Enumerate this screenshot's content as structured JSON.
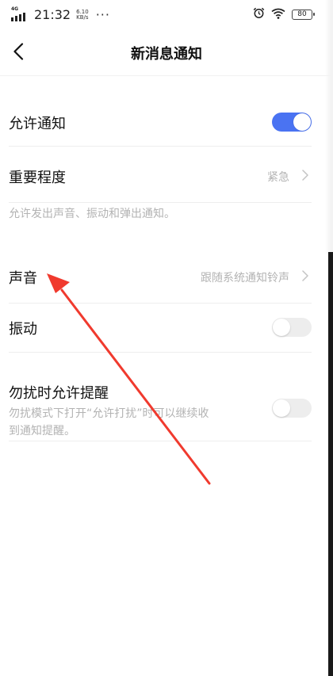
{
  "status_bar": {
    "network_type": "4G",
    "time": "21:32",
    "speed_value": "6.10",
    "speed_unit": "KB/s",
    "more": "···",
    "battery": "80",
    "icons": [
      "signal-icon",
      "alarm-icon",
      "wifi-icon",
      "battery-icon"
    ]
  },
  "header": {
    "title": "新消息通知",
    "back_icon": "chevron-left-icon"
  },
  "settings": {
    "allow_notify": {
      "label": "允许通知",
      "enabled": true
    },
    "importance": {
      "label": "重要程度",
      "value": "紧急"
    },
    "importance_hint": "允许发出声音、振动和弹出通知。",
    "sound": {
      "label": "声音",
      "value": "跟随系统通知铃声"
    },
    "vibration": {
      "label": "振动",
      "enabled": false
    },
    "dnd_allow": {
      "label": "勿扰时允许提醒",
      "desc_line1": "勿扰模式下打开“允许打扰”时可以继续收",
      "desc_line2": "到通知提醒。",
      "enabled": false
    }
  },
  "colors": {
    "accent": "#4a73f2",
    "toggle_off": "#ededed",
    "secondary_text": "#b3b3b3",
    "annotation_arrow": "#f03a2e"
  }
}
